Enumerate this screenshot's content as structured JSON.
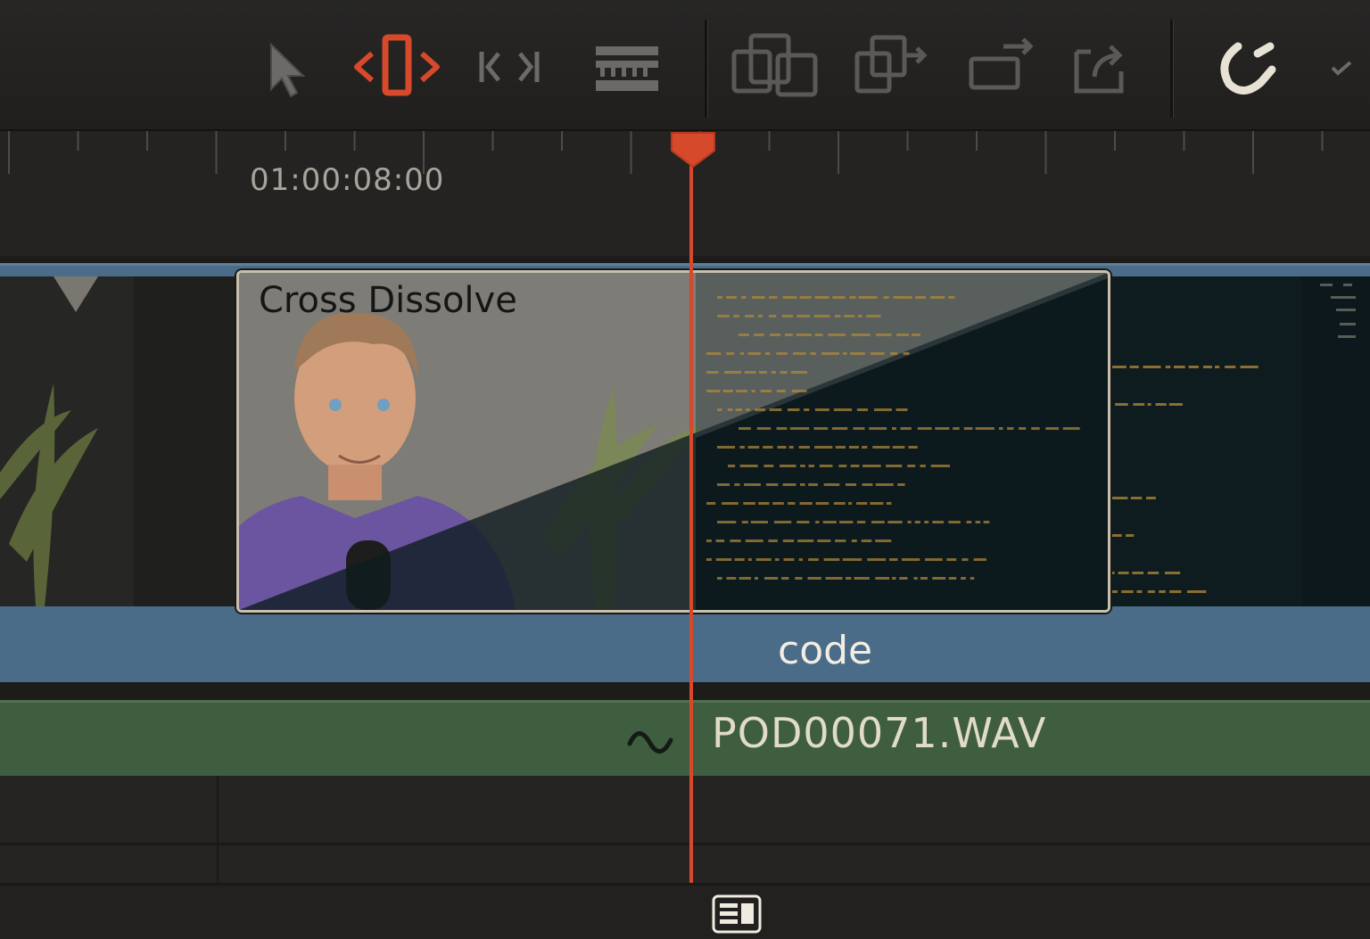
{
  "toolbar": {
    "tools": [
      {
        "name": "selection-mode-tool",
        "icon": "arrow-pointer-icon",
        "active": false
      },
      {
        "name": "trim-edit-mode-tool",
        "icon": "trim-icon",
        "active": true
      },
      {
        "name": "dynamic-trim-mode-tool",
        "icon": "dynamic-trim-icon",
        "active": false
      },
      {
        "name": "blade-edit-mode-tool",
        "icon": "blade-icon",
        "active": false
      },
      {
        "name": "insert-clip-tool",
        "icon": "insert-clip-icon",
        "active": false
      },
      {
        "name": "overwrite-clip-tool",
        "icon": "overwrite-clip-icon",
        "active": false
      },
      {
        "name": "replace-clip-tool",
        "icon": "replace-clip-icon",
        "active": false
      },
      {
        "name": "place-on-top-tool",
        "icon": "place-on-top-icon",
        "active": false
      },
      {
        "name": "snapping-toggle",
        "icon": "magnet-icon",
        "active": true
      },
      {
        "name": "linked-selection-toggle",
        "icon": "link-icon",
        "active": false
      }
    ]
  },
  "ruler": {
    "timecode": "01:00:08:00"
  },
  "video_track": {
    "transition_label": "Cross Dissolve",
    "clip_name": "code",
    "clip_icon": "compound-clip-icon"
  },
  "audio_track": {
    "clip_name": "POD00071.WAV",
    "clip_icon": "waveform-icon"
  },
  "colors": {
    "accent": "#d6492a",
    "video_track": "#4a6c88",
    "audio_track": "#3f5d3f",
    "background": "#222120"
  }
}
